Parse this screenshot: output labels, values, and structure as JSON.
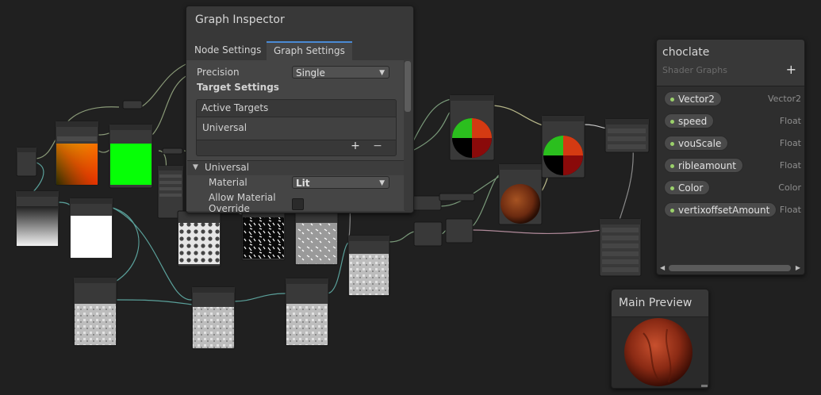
{
  "inspector": {
    "title": "Graph Inspector",
    "tabs": [
      "Node Settings",
      "Graph Settings"
    ],
    "active_tab": "Graph Settings",
    "precision_label": "Precision",
    "precision_value": "Single",
    "target_settings_label": "Target Settings",
    "active_targets_label": "Active Targets",
    "active_target_item": "Universal",
    "add_glyph": "+",
    "remove_glyph": "−",
    "universal_section": "Universal",
    "material_label": "Material",
    "material_value": "Lit",
    "allow_override_label": "Allow Material Override"
  },
  "blackboard": {
    "title": "choclate",
    "subtitle": "Shader Graphs",
    "add_glyph": "+",
    "properties": [
      {
        "name": "Vector2",
        "type": "Vector2"
      },
      {
        "name": "speed",
        "type": "Float"
      },
      {
        "name": "vouScale",
        "type": "Float"
      },
      {
        "name": "ribleamount",
        "type": "Float"
      },
      {
        "name": "Color",
        "type": "Color"
      },
      {
        "name": "vertixoffsetAmount",
        "type": "Float"
      }
    ]
  },
  "main_preview": {
    "title": "Main Preview"
  },
  "colors": {
    "accent": "#4a8ad4",
    "property_dot": "#9bd16b",
    "background": "#202020",
    "panel": "#383838"
  },
  "icons": [
    "add-icon",
    "remove-icon",
    "foldout-arrow-icon",
    "dropdown-arrow-icon",
    "scrollbar-left-arrow-icon",
    "scrollbar-right-arrow-icon",
    "resize-handle-icon"
  ]
}
